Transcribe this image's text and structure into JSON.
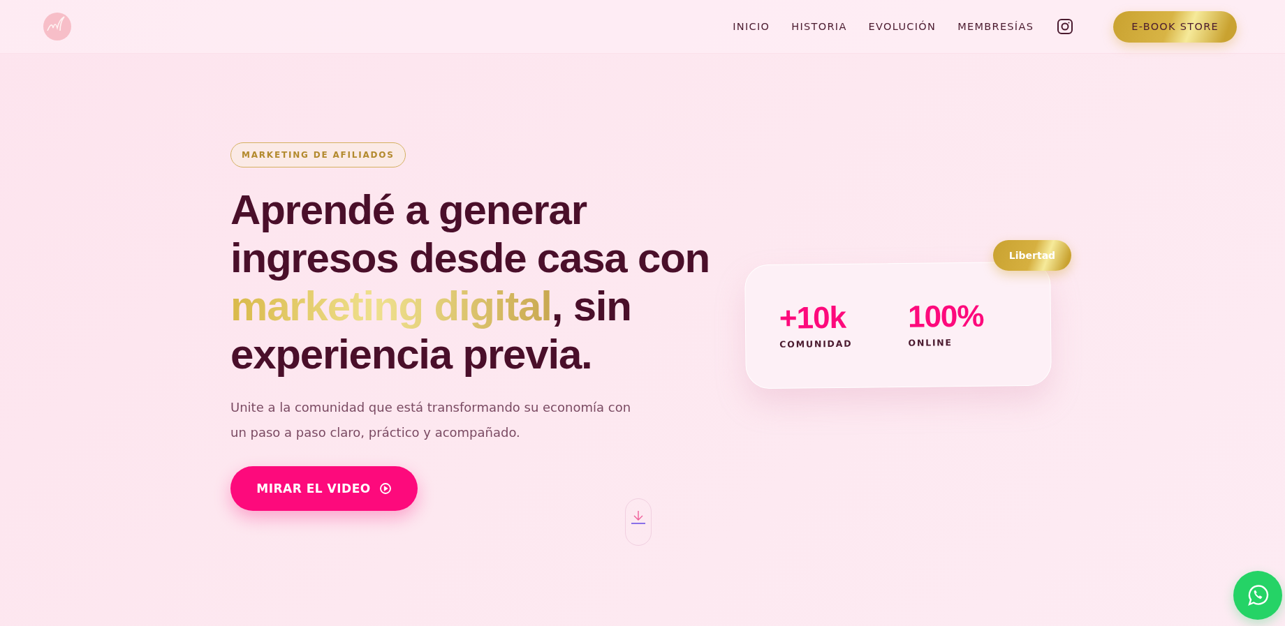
{
  "nav": {
    "items": [
      {
        "label": "INICIO"
      },
      {
        "label": "HISTORIA"
      },
      {
        "label": "EVOLUCIÓN"
      },
      {
        "label": "MEMBRESÍAS"
      }
    ],
    "store_button": "E-BOOK STORE"
  },
  "hero": {
    "tag": "MARKETING DE AFILIADOS",
    "headline": {
      "before": "Aprendé a generar ingresos desde casa con ",
      "highlight": "marketing digital",
      "after": ", sin experiencia previa."
    },
    "subtitle": "Unite a la comunidad que está transformando su economía con un paso a paso claro, práctico y acompañado.",
    "cta": "MIRAR EL VIDEO"
  },
  "stats_card": {
    "badge": "Libertad",
    "stats": [
      {
        "value": "+10k",
        "label": "COMUNIDAD"
      },
      {
        "value": "100%",
        "label": "ONLINE"
      }
    ]
  }
}
